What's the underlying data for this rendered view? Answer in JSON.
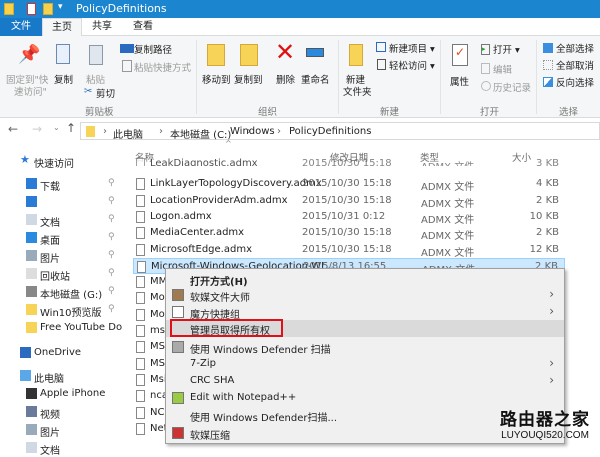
{
  "window": {
    "title": "PolicyDefinitions"
  },
  "tabs": [
    {
      "label": "文件"
    },
    {
      "label": "主页"
    },
    {
      "label": "共享"
    },
    {
      "label": "查看"
    }
  ],
  "ribbon": {
    "clipboard": {
      "pin": "固定到\"快",
      "pin2": "速访问\"",
      "copy": "复制",
      "paste": "粘贴",
      "copy_path": "复制路径",
      "paste_shortcut": "粘贴快捷方式",
      "cut": "剪切",
      "group": "剪贴板"
    },
    "organize": {
      "move_to": "移动到",
      "copy_to": "复制到",
      "delete": "删除",
      "rename": "重命名",
      "group": "组织"
    },
    "new": {
      "new_folder": "新建",
      "new_folder2": "文件夹",
      "new_item": "新建项目",
      "easy_access": "轻松访问",
      "group": "新建"
    },
    "open": {
      "properties": "属性",
      "open": "打开",
      "edit": "编辑",
      "history": "历史记录",
      "group": "打开"
    },
    "select": {
      "select_all": "全部选择",
      "select_none": "全部取消",
      "invert": "反向选择",
      "group": "选择"
    }
  },
  "breadcrumb": [
    "此电脑",
    "本地磁盘 (C:)",
    "Windows",
    "PolicyDefinitions"
  ],
  "nav": [
    {
      "label": "快速访问",
      "icon": "star-icon"
    },
    {
      "label": "下载",
      "icon": "download-icon",
      "pinned": true
    },
    {
      "label": "",
      "icon": "download-icon",
      "pinned": true
    },
    {
      "label": "文档",
      "icon": "document-icon",
      "pinned": true
    },
    {
      "label": "桌面",
      "icon": "desktop-icon",
      "pinned": true
    },
    {
      "label": "图片",
      "icon": "pictures-icon",
      "pinned": true
    },
    {
      "label": "回收站",
      "icon": "recycle-bin-icon",
      "pinned": true
    },
    {
      "label": "本地磁盘 (G:)",
      "icon": "drive-icon",
      "pinned": true
    },
    {
      "label": "Win10预览版",
      "icon": "folder-icon",
      "pinned": true
    },
    {
      "label": "Free YouTube Do",
      "icon": "folder-icon"
    },
    {
      "label": "OneDrive",
      "icon": "onedrive-icon"
    },
    {
      "label": "此电脑",
      "icon": "pc-icon"
    },
    {
      "label": "Apple iPhone",
      "icon": "phone-icon"
    },
    {
      "label": "视频",
      "icon": "video-icon"
    },
    {
      "label": "图片",
      "icon": "pictures-icon"
    },
    {
      "label": "文档",
      "icon": "document-icon"
    }
  ],
  "columns": {
    "name": "名称",
    "date": "修改日期",
    "type": "类型",
    "size": "大小"
  },
  "files": [
    {
      "name": "LeakDiagnostic.admx",
      "date": "2015/10/30 15:18",
      "type": "ADMX 文件",
      "size": "3 KB"
    },
    {
      "name": "LinkLayerTopologyDiscovery.admx",
      "date": "2015/10/30 15:18",
      "type": "ADMX 文件",
      "size": "4 KB"
    },
    {
      "name": "LocationProviderAdm.admx",
      "date": "2015/10/30 15:18",
      "type": "ADMX 文件",
      "size": "2 KB"
    },
    {
      "name": "Logon.admx",
      "date": "2015/10/31 0:12",
      "type": "ADMX 文件",
      "size": "10 KB"
    },
    {
      "name": "MediaCenter.admx",
      "date": "2015/10/30 15:18",
      "type": "ADMX 文件",
      "size": "2 KB"
    },
    {
      "name": "MicrosoftEdge.admx",
      "date": "2015/10/30 15:18",
      "type": "ADMX 文件",
      "size": "12 KB"
    },
    {
      "name": "Microsoft-Windows-Geolocation-WL...",
      "date": "2015/8/13 16:55",
      "type": "ADMX 文件",
      "size": "2 KB"
    },
    {
      "name": "MM"
    },
    {
      "name": "Mo"
    },
    {
      "name": "Mo"
    },
    {
      "name": "msc"
    },
    {
      "name": "MS"
    },
    {
      "name": "MS"
    },
    {
      "name": "Msi"
    },
    {
      "name": "nca"
    },
    {
      "name": "NCS"
    },
    {
      "name": "Net"
    }
  ],
  "context_menu": [
    {
      "label": "打开方式(H)",
      "bold": true
    },
    {
      "label": "软媒文件大师",
      "icon": "ruanmei-icon",
      "submenu": true
    },
    {
      "label": "魔方快捷组",
      "icon": "grid-icon",
      "submenu": true
    },
    {
      "label": "管理员取得所有权",
      "highlighted": true
    },
    {
      "label": "使用 Windows Defender 扫描",
      "icon": "defender-icon"
    },
    {
      "label": "7-Zip",
      "submenu": true
    },
    {
      "label": "CRC SHA",
      "submenu": true
    },
    {
      "label": "Edit with Notepad++",
      "icon": "notepadpp-icon"
    },
    {
      "label": "使用 Windows Defender扫描..."
    },
    {
      "label": "软媒压缩",
      "icon": "archive-icon"
    }
  ],
  "watermark": {
    "title": "路由器之家",
    "url": "LUYOUQI520.COM"
  }
}
